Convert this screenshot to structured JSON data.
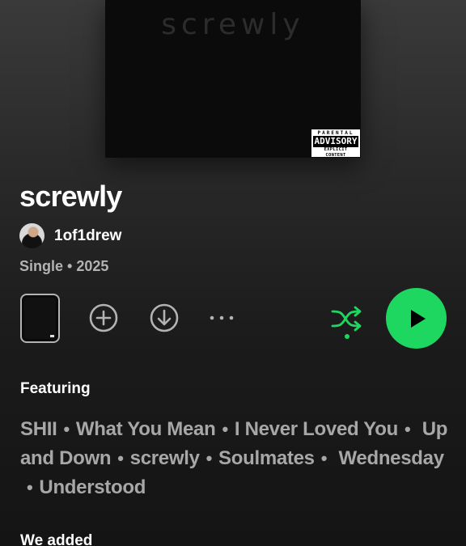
{
  "cover": {
    "title": "screwly",
    "advisory_top": "PARENTAL",
    "advisory_mid": "ADVISORY",
    "advisory_bottom": "EXPLICIT CONTENT"
  },
  "album": {
    "title": "screwly",
    "artist": "1of1drew",
    "meta": "Single • 2025"
  },
  "controls": {
    "add_icon": "add-circle-icon",
    "download_icon": "download-icon",
    "more_icon": "more-icon",
    "shuffle_icon": "shuffle-icon",
    "play_icon": "play-icon",
    "accent_color": "#1ed760"
  },
  "featuring": {
    "label": "Featuring",
    "tracks": [
      "SHII",
      "What You Mean",
      "I Never Loved You",
      "Up and Down",
      "screwly",
      "Soulmates",
      "Wednesday",
      "Understood"
    ]
  },
  "next_section": {
    "label": "We added"
  }
}
